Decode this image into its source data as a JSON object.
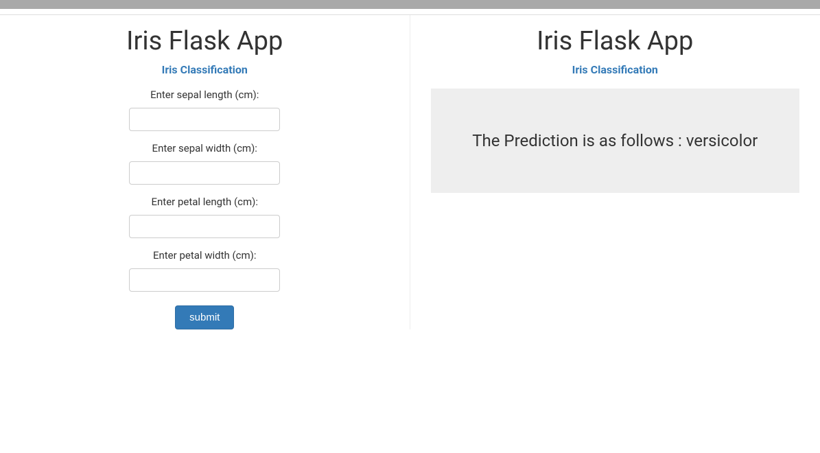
{
  "left": {
    "title": "Iris Flask App",
    "subtitle": "Iris Classification",
    "fields": {
      "sepal_length": {
        "label": "Enter sepal length (cm):"
      },
      "sepal_width": {
        "label": "Enter sepal width (cm):"
      },
      "petal_length": {
        "label": "Enter petal length (cm):"
      },
      "petal_width": {
        "label": "Enter petal width (cm):"
      }
    },
    "submit_label": "submit"
  },
  "right": {
    "title": "Iris Flask App",
    "subtitle": "Iris Classification",
    "prediction_text": "The Prediction is as follows : versicolor"
  }
}
